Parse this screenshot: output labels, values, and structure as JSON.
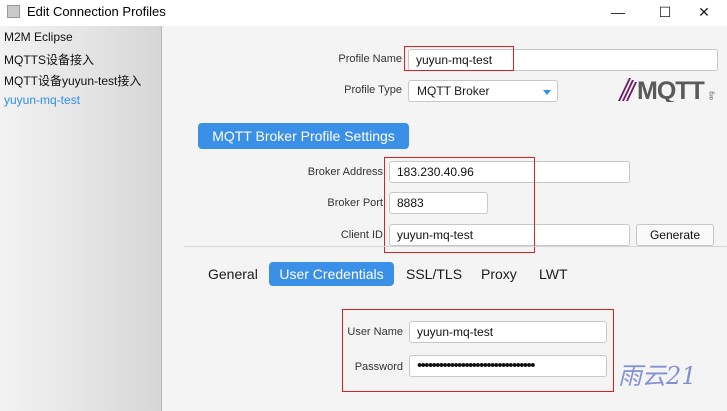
{
  "window": {
    "title": "Edit Connection Profiles",
    "minimize_glyph": "—",
    "maximize_glyph": "☐",
    "close_glyph": "✕"
  },
  "sidebar": {
    "items": [
      {
        "label": "M2M Eclipse"
      },
      {
        "label": "MQTTS设备接入"
      },
      {
        "label": "MQTT设备yuyun-test接入"
      },
      {
        "label": "yuyun-mq-test"
      }
    ]
  },
  "profile": {
    "name_label": "Profile Name",
    "name_value": "yuyun-mq-test",
    "type_label": "Profile Type",
    "type_value": "MQTT Broker"
  },
  "logo": {
    "text": "MQTT",
    "small": "org"
  },
  "section": {
    "title": "MQTT Broker Profile Settings"
  },
  "broker": {
    "address_label": "Broker Address",
    "address_value": "183.230.40.96",
    "port_label": "Broker Port",
    "port_value": "8883",
    "client_label": "Client ID",
    "client_value": "yuyun-mq-test",
    "generate_label": "Generate"
  },
  "tabs": [
    {
      "label": "General"
    },
    {
      "label": "User Credentials"
    },
    {
      "label": "SSL/TLS"
    },
    {
      "label": "Proxy"
    },
    {
      "label": "LWT"
    }
  ],
  "credentials": {
    "user_label": "User Name",
    "user_value": "yuyun-mq-test",
    "password_label": "Password",
    "password_value": "••••••••••••••••••••••••••••••••"
  },
  "watermark": {
    "text": "雨云21"
  },
  "colors": {
    "accent": "#3a8fe6",
    "highlight": "#e02020",
    "sidebar_active": "#2f8fe9"
  }
}
